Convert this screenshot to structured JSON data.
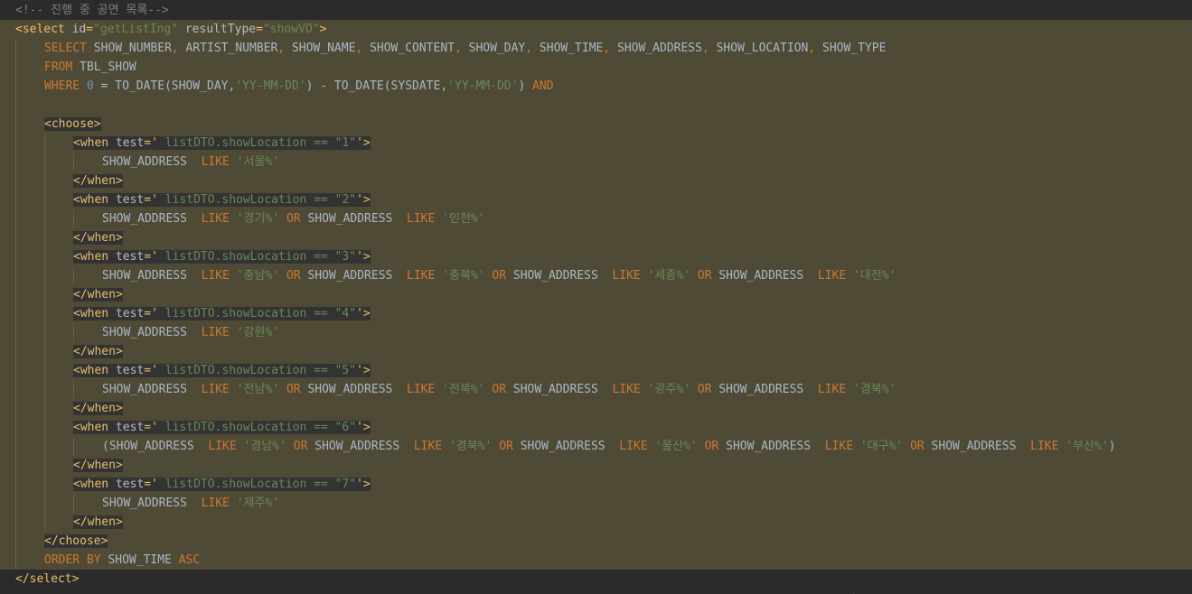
{
  "editor": {
    "theme_colors": {
      "background": "#2b2b2b",
      "injected_sql_background": "#4f4a35",
      "tag": "#e8bf6a",
      "keyword": "#cc7832",
      "string": "#6a8759",
      "number": "#6897bb",
      "comment": "#808080",
      "text": "#a9b7c6"
    },
    "lines": [
      {
        "hl": false,
        "indent": 0,
        "segments": [
          {
            "c": "comment",
            "t": "<!-- 진행 중 공연 목록-->"
          }
        ]
      },
      {
        "hl": true,
        "indent": 0,
        "segments": [
          {
            "c": "tag",
            "t": "<select "
          },
          {
            "c": "attr",
            "t": "id"
          },
          {
            "c": "tag",
            "t": "="
          },
          {
            "c": "aval",
            "t": "\"getListIng\""
          },
          {
            "c": "tag",
            "t": " "
          },
          {
            "c": "attr",
            "t": "resultType"
          },
          {
            "c": "tag",
            "t": "="
          },
          {
            "c": "aval",
            "t": "\"showVO\""
          },
          {
            "c": "tag",
            "t": ">"
          }
        ]
      },
      {
        "hl": true,
        "indent": 1,
        "segments": [
          {
            "c": "kw",
            "t": "SELECT "
          },
          {
            "c": "ph",
            "t": "SHOW_NUMBER"
          },
          {
            "c": "kw",
            "t": ", "
          },
          {
            "c": "ph",
            "t": "ARTIST_NUMBER"
          },
          {
            "c": "kw",
            "t": ", "
          },
          {
            "c": "ph",
            "t": "SHOW_NAME"
          },
          {
            "c": "kw",
            "t": ", "
          },
          {
            "c": "ph",
            "t": "SHOW_CONTENT"
          },
          {
            "c": "kw",
            "t": ", "
          },
          {
            "c": "ph",
            "t": "SHOW_DAY"
          },
          {
            "c": "kw",
            "t": ", "
          },
          {
            "c": "ph",
            "t": "SHOW_TIME"
          },
          {
            "c": "kw",
            "t": ", "
          },
          {
            "c": "ph",
            "t": "SHOW_ADDRESS"
          },
          {
            "c": "kw",
            "t": ", "
          },
          {
            "c": "ph",
            "t": "SHOW_LOCATION"
          },
          {
            "c": "kw",
            "t": ", "
          },
          {
            "c": "ph",
            "t": "SHOW_TYPE"
          }
        ]
      },
      {
        "hl": true,
        "indent": 1,
        "segments": [
          {
            "c": "kw",
            "t": "FROM "
          },
          {
            "c": "ph",
            "t": "TBL_SHOW"
          }
        ]
      },
      {
        "hl": true,
        "indent": 1,
        "segments": [
          {
            "c": "kw",
            "t": "WHERE "
          },
          {
            "c": "num",
            "t": "0"
          },
          {
            "c": "ph",
            "t": " = TO_DATE(SHOW_DAY,"
          },
          {
            "c": "str",
            "t": "'YY-MM-DD'"
          },
          {
            "c": "ph",
            "t": ") - TO_DATE(SYSDATE,"
          },
          {
            "c": "str",
            "t": "'YY-MM-DD'"
          },
          {
            "c": "ph",
            "t": ") "
          },
          {
            "c": "kw",
            "t": "AND"
          }
        ]
      },
      {
        "hl": true,
        "indent": 1,
        "segments": []
      },
      {
        "hl": true,
        "indent": 1,
        "segments": [
          {
            "c": "tag",
            "t": "<choose>",
            "bg": true
          }
        ]
      },
      {
        "hl": true,
        "indent": 2,
        "segments": [
          {
            "c": "tag",
            "t": "<when ",
            "bg": true
          },
          {
            "c": "attr",
            "t": "test",
            "bg": true
          },
          {
            "c": "tag",
            "t": "='",
            "bg": true
          },
          {
            "c": "expr",
            "t": " listDTO.showLocation == \"1\"",
            "bg": true
          },
          {
            "c": "tag",
            "t": "'>",
            "bg": true
          }
        ]
      },
      {
        "hl": true,
        "indent": 3,
        "segments": [
          {
            "c": "ph",
            "t": "SHOW_ADDRESS  "
          },
          {
            "c": "kw",
            "t": "LIKE "
          },
          {
            "c": "str",
            "t": "'서울%'"
          }
        ]
      },
      {
        "hl": true,
        "indent": 2,
        "segments": [
          {
            "c": "tag",
            "t": "</when>",
            "bg": true
          }
        ]
      },
      {
        "hl": true,
        "indent": 2,
        "segments": [
          {
            "c": "tag",
            "t": "<when ",
            "bg": true
          },
          {
            "c": "attr",
            "t": "test",
            "bg": true
          },
          {
            "c": "tag",
            "t": "='",
            "bg": true
          },
          {
            "c": "expr",
            "t": " listDTO.showLocation == \"2\"",
            "bg": true
          },
          {
            "c": "tag",
            "t": "'>",
            "bg": true
          }
        ]
      },
      {
        "hl": true,
        "indent": 3,
        "segments": [
          {
            "c": "ph",
            "t": "SHOW_ADDRESS  "
          },
          {
            "c": "kw",
            "t": "LIKE "
          },
          {
            "c": "str",
            "t": "'경기%'"
          },
          {
            "c": "kw",
            "t": " OR "
          },
          {
            "c": "ph",
            "t": "SHOW_ADDRESS  "
          },
          {
            "c": "kw",
            "t": "LIKE "
          },
          {
            "c": "str",
            "t": "'인천%'"
          }
        ]
      },
      {
        "hl": true,
        "indent": 2,
        "segments": [
          {
            "c": "tag",
            "t": "</when>",
            "bg": true
          }
        ]
      },
      {
        "hl": true,
        "indent": 2,
        "segments": [
          {
            "c": "tag",
            "t": "<when ",
            "bg": true
          },
          {
            "c": "attr",
            "t": "test",
            "bg": true
          },
          {
            "c": "tag",
            "t": "='",
            "bg": true
          },
          {
            "c": "expr",
            "t": " listDTO.showLocation == \"3\"",
            "bg": true
          },
          {
            "c": "tag",
            "t": "'>",
            "bg": true
          }
        ]
      },
      {
        "hl": true,
        "indent": 3,
        "segments": [
          {
            "c": "ph",
            "t": "SHOW_ADDRESS  "
          },
          {
            "c": "kw",
            "t": "LIKE "
          },
          {
            "c": "str",
            "t": "'충남%'"
          },
          {
            "c": "kw",
            "t": " OR "
          },
          {
            "c": "ph",
            "t": "SHOW_ADDRESS  "
          },
          {
            "c": "kw",
            "t": "LIKE "
          },
          {
            "c": "str",
            "t": "'충북%'"
          },
          {
            "c": "kw",
            "t": " OR "
          },
          {
            "c": "ph",
            "t": "SHOW_ADDRESS  "
          },
          {
            "c": "kw",
            "t": "LIKE "
          },
          {
            "c": "str",
            "t": "'세종%'"
          },
          {
            "c": "kw",
            "t": " OR "
          },
          {
            "c": "ph",
            "t": "SHOW_ADDRESS  "
          },
          {
            "c": "kw",
            "t": "LIKE "
          },
          {
            "c": "str",
            "t": "'대전%'"
          }
        ]
      },
      {
        "hl": true,
        "indent": 2,
        "segments": [
          {
            "c": "tag",
            "t": "</when>",
            "bg": true
          }
        ]
      },
      {
        "hl": true,
        "indent": 2,
        "segments": [
          {
            "c": "tag",
            "t": "<when ",
            "bg": true
          },
          {
            "c": "attr",
            "t": "test",
            "bg": true
          },
          {
            "c": "tag",
            "t": "='",
            "bg": true
          },
          {
            "c": "expr",
            "t": " listDTO.showLocation == \"4\"",
            "bg": true
          },
          {
            "c": "tag",
            "t": "'>",
            "bg": true
          }
        ]
      },
      {
        "hl": true,
        "indent": 3,
        "segments": [
          {
            "c": "ph",
            "t": "SHOW_ADDRESS  "
          },
          {
            "c": "kw",
            "t": "LIKE "
          },
          {
            "c": "str",
            "t": "'강원%'"
          }
        ]
      },
      {
        "hl": true,
        "indent": 2,
        "segments": [
          {
            "c": "tag",
            "t": "</when>",
            "bg": true
          }
        ]
      },
      {
        "hl": true,
        "indent": 2,
        "segments": [
          {
            "c": "tag",
            "t": "<when ",
            "bg": true
          },
          {
            "c": "attr",
            "t": "test",
            "bg": true
          },
          {
            "c": "tag",
            "t": "='",
            "bg": true
          },
          {
            "c": "expr",
            "t": " listDTO.showLocation == \"5\"",
            "bg": true
          },
          {
            "c": "tag",
            "t": "'>",
            "bg": true
          }
        ]
      },
      {
        "hl": true,
        "indent": 3,
        "segments": [
          {
            "c": "ph",
            "t": "SHOW_ADDRESS  "
          },
          {
            "c": "kw",
            "t": "LIKE "
          },
          {
            "c": "str",
            "t": "'전남%'"
          },
          {
            "c": "kw",
            "t": " OR "
          },
          {
            "c": "ph",
            "t": "SHOW_ADDRESS  "
          },
          {
            "c": "kw",
            "t": "LIKE "
          },
          {
            "c": "str",
            "t": "'전북%'"
          },
          {
            "c": "kw",
            "t": " OR "
          },
          {
            "c": "ph",
            "t": "SHOW_ADDRESS  "
          },
          {
            "c": "kw",
            "t": "LIKE "
          },
          {
            "c": "str",
            "t": "'광주%'"
          },
          {
            "c": "kw",
            "t": " OR "
          },
          {
            "c": "ph",
            "t": "SHOW_ADDRESS  "
          },
          {
            "c": "kw",
            "t": "LIKE "
          },
          {
            "c": "str",
            "t": "'경북%'"
          }
        ]
      },
      {
        "hl": true,
        "indent": 2,
        "segments": [
          {
            "c": "tag",
            "t": "</when>",
            "bg": true
          }
        ]
      },
      {
        "hl": true,
        "indent": 2,
        "segments": [
          {
            "c": "tag",
            "t": "<when ",
            "bg": true
          },
          {
            "c": "attr",
            "t": "test",
            "bg": true
          },
          {
            "c": "tag",
            "t": "='",
            "bg": true
          },
          {
            "c": "expr",
            "t": " listDTO.showLocation == \"6\"",
            "bg": true
          },
          {
            "c": "tag",
            "t": "'>",
            "bg": true
          }
        ]
      },
      {
        "hl": true,
        "indent": 3,
        "segments": [
          {
            "c": "ph",
            "t": "(SHOW_ADDRESS  "
          },
          {
            "c": "kw",
            "t": "LIKE "
          },
          {
            "c": "str",
            "t": "'경남%'"
          },
          {
            "c": "kw",
            "t": " OR "
          },
          {
            "c": "ph",
            "t": "SHOW_ADDRESS  "
          },
          {
            "c": "kw",
            "t": "LIKE "
          },
          {
            "c": "str",
            "t": "'경북%'"
          },
          {
            "c": "kw",
            "t": " OR "
          },
          {
            "c": "ph",
            "t": "SHOW_ADDRESS  "
          },
          {
            "c": "kw",
            "t": "LIKE "
          },
          {
            "c": "str",
            "t": "'울산%'"
          },
          {
            "c": "kw",
            "t": " OR "
          },
          {
            "c": "ph",
            "t": "SHOW_ADDRESS  "
          },
          {
            "c": "kw",
            "t": "LIKE "
          },
          {
            "c": "str",
            "t": "'대구%'"
          },
          {
            "c": "kw",
            "t": " OR "
          },
          {
            "c": "ph",
            "t": "SHOW_ADDRESS  "
          },
          {
            "c": "kw",
            "t": "LIKE "
          },
          {
            "c": "str",
            "t": "'부산%'"
          },
          {
            "c": "ph",
            "t": ")"
          }
        ]
      },
      {
        "hl": true,
        "indent": 2,
        "segments": [
          {
            "c": "tag",
            "t": "</when>",
            "bg": true
          }
        ]
      },
      {
        "hl": true,
        "indent": 2,
        "segments": [
          {
            "c": "tag",
            "t": "<when ",
            "bg": true
          },
          {
            "c": "attr",
            "t": "test",
            "bg": true
          },
          {
            "c": "tag",
            "t": "='",
            "bg": true
          },
          {
            "c": "expr",
            "t": " listDTO.showLocation == \"7\"",
            "bg": true
          },
          {
            "c": "tag",
            "t": "'>",
            "bg": true
          }
        ]
      },
      {
        "hl": true,
        "indent": 3,
        "segments": [
          {
            "c": "ph",
            "t": "SHOW_ADDRESS  "
          },
          {
            "c": "kw",
            "t": "LIKE "
          },
          {
            "c": "str",
            "t": "'제주%'"
          }
        ]
      },
      {
        "hl": true,
        "indent": 2,
        "segments": [
          {
            "c": "tag",
            "t": "</when>",
            "bg": true
          }
        ]
      },
      {
        "hl": true,
        "indent": 1,
        "segments": [
          {
            "c": "tag",
            "t": "</choose>",
            "bg": true
          }
        ]
      },
      {
        "hl": true,
        "indent": 1,
        "segments": [
          {
            "c": "kw",
            "t": "ORDER BY "
          },
          {
            "c": "ph",
            "t": "SHOW_TIME "
          },
          {
            "c": "kw",
            "t": "ASC"
          }
        ]
      },
      {
        "hl": false,
        "indent": 0,
        "segments": [
          {
            "c": "tag",
            "t": "</select>"
          }
        ]
      }
    ]
  }
}
